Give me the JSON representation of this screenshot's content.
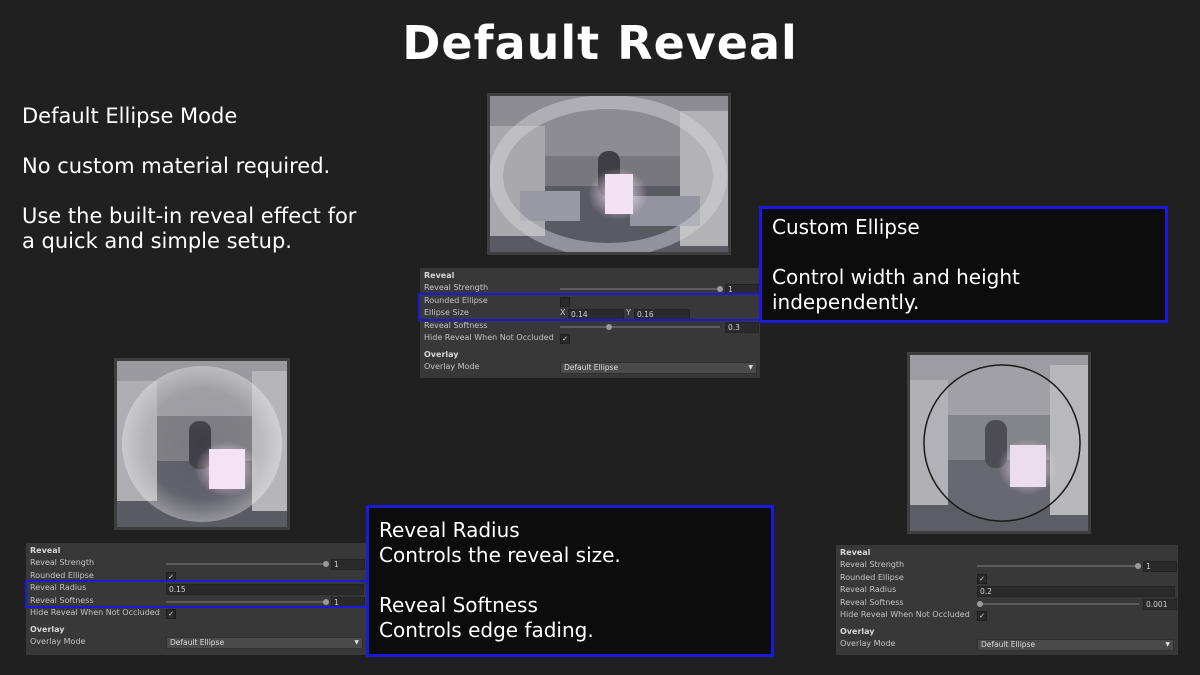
{
  "title": "Default Reveal",
  "intro": {
    "heading": "Default Ellipse Mode",
    "line1": "No custom material required.",
    "line2": "Use the built-in reveal effect for",
    "line3": "a quick and simple setup."
  },
  "callouts": {
    "custom_ellipse": {
      "heading": "Custom Ellipse",
      "line1": "Control width and height",
      "line2": "independently."
    },
    "radius_softness": {
      "line1": "Reveal Radius",
      "line2": "Controls the reveal size.",
      "line3": "Reveal Softness",
      "line4": "Controls edge fading."
    }
  },
  "panel_top": {
    "section": "Reveal",
    "reveal_strength_label": "Reveal Strength",
    "reveal_strength": "1",
    "rounded_ellipse_label": "Rounded Ellipse",
    "ellipse_size_label": "Ellipse Size",
    "x_label": "X",
    "x_value": "0.14",
    "y_label": "Y",
    "y_value": "0.16",
    "softness_label": "Reveal Softness",
    "softness": "0.3",
    "hide_label": "Hide Reveal When Not Occluded",
    "hide_check": "✓",
    "overlay_section": "Overlay",
    "overlay_mode_label": "Overlay Mode",
    "overlay_mode": "Default Ellipse"
  },
  "panel_left": {
    "section": "Reveal",
    "reveal_strength_label": "Reveal Strength",
    "reveal_strength": "1",
    "rounded_ellipse_label": "Rounded Ellipse",
    "rounded_check": "✓",
    "radius_label": "Reveal Radius",
    "radius": "0.15",
    "softness_label": "Reveal Softness",
    "softness": "1",
    "hide_label": "Hide Reveal When Not Occluded",
    "hide_check": "✓",
    "overlay_section": "Overlay",
    "overlay_mode_label": "Overlay Mode",
    "overlay_mode": "Default Ellipse"
  },
  "panel_right": {
    "section": "Reveal",
    "reveal_strength_label": "Reveal Strength",
    "reveal_strength": "1",
    "rounded_ellipse_label": "Rounded Ellipse",
    "rounded_check": "✓",
    "radius_label": "Reveal Radius",
    "radius": "0.2",
    "softness_label": "Reveal Softness",
    "softness": "0.001",
    "hide_label": "Hide Reveal When Not Occluded",
    "hide_check": "✓",
    "overlay_section": "Overlay",
    "overlay_mode_label": "Overlay Mode",
    "overlay_mode": "Default Ellipse"
  },
  "colors": {
    "background": "#202020",
    "panel": "#383838",
    "highlight": "#1a1ad8"
  },
  "icons": {
    "dropdown": "chevron-down-icon",
    "check": "checkmark-icon"
  }
}
